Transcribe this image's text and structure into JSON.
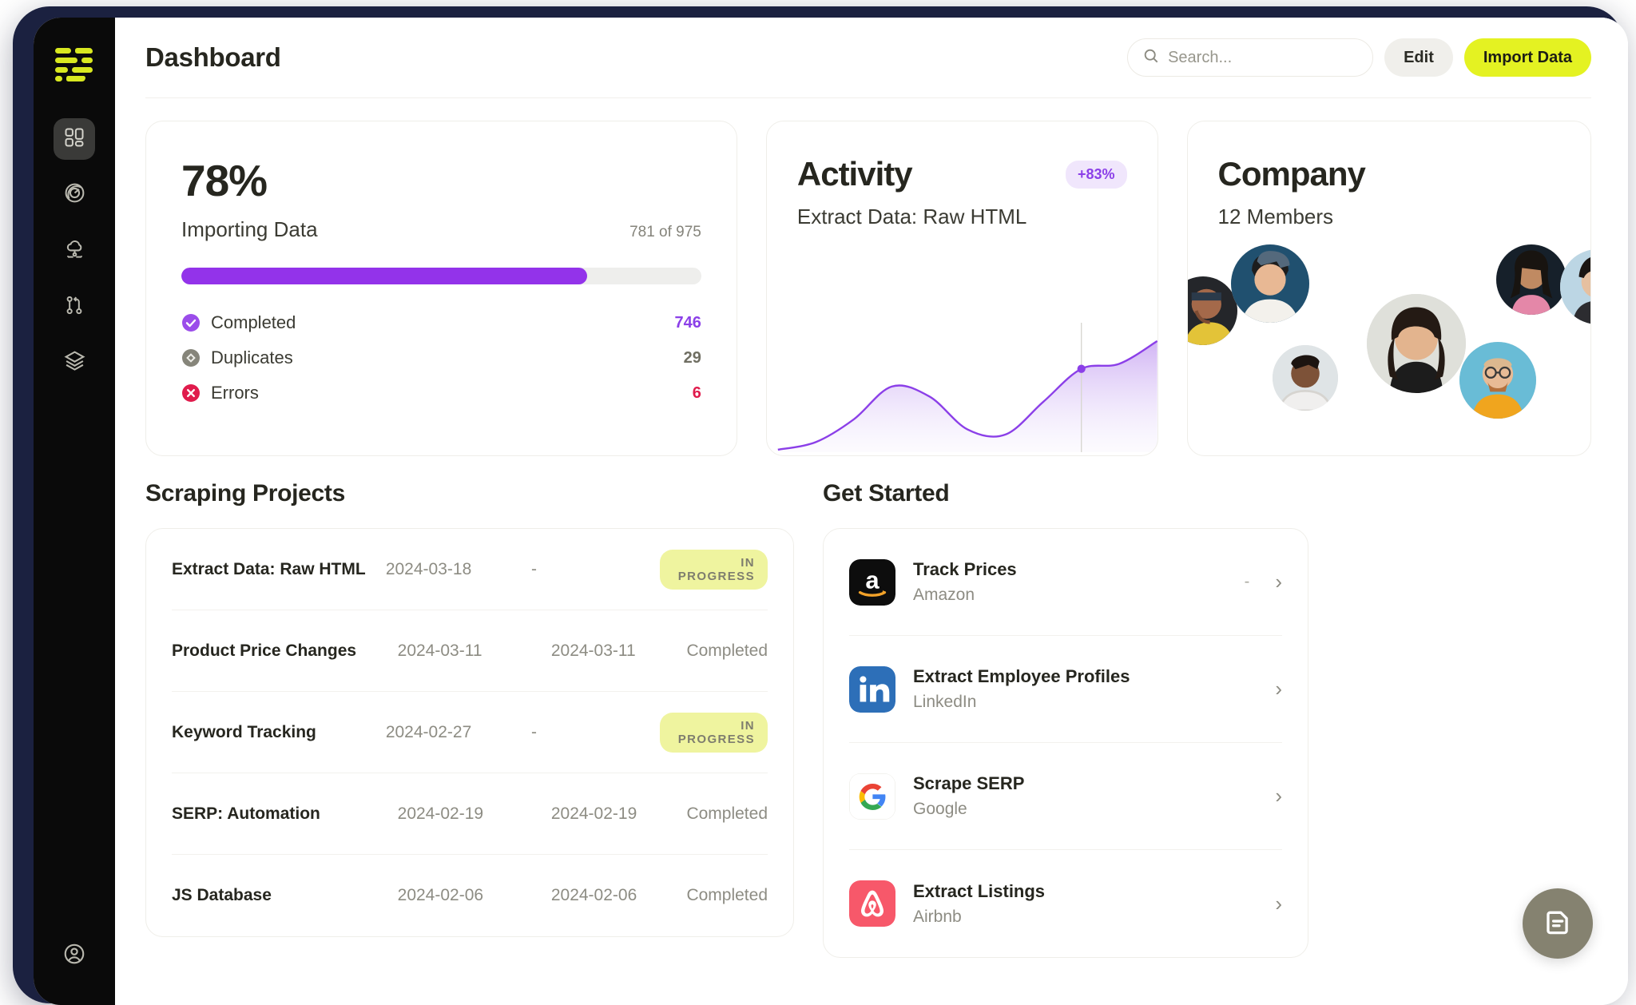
{
  "brand": {
    "logo_name": "app-logo",
    "logo_color": "#d8e820",
    "accent": "#e4f222",
    "purple": "#9333ea"
  },
  "sidebar": {
    "items": [
      {
        "icon": "dashboard-grid-icon",
        "label": "Dashboard",
        "active": true
      },
      {
        "icon": "radar-target-icon",
        "label": "Monitor",
        "active": false
      },
      {
        "icon": "cloud-network-icon",
        "label": "Cloud",
        "active": false
      },
      {
        "icon": "git-branch-icon",
        "label": "Workflows",
        "active": false
      },
      {
        "icon": "layers-icon",
        "label": "Datasets",
        "active": false
      }
    ],
    "account": {
      "icon": "user-circle-icon",
      "label": "Account"
    }
  },
  "header": {
    "title": "Dashboard",
    "search": {
      "placeholder": "Search...",
      "value": "",
      "icon": "search-icon"
    },
    "edit_label": "Edit",
    "import_label": "Import Data"
  },
  "progress_card": {
    "percent": "78%",
    "percent_value": 78,
    "title": "Importing Data",
    "count": "781 of 975",
    "stats": [
      {
        "icon": "check-circle-icon",
        "label": "Completed",
        "value": "746",
        "color": "#9333ea"
      },
      {
        "icon": "diamond-circle-icon",
        "label": "Duplicates",
        "value": "29",
        "color": "#6f6e62"
      },
      {
        "icon": "x-circle-icon",
        "label": "Errors",
        "value": "6",
        "color": "#e01b4c"
      }
    ]
  },
  "activity_card": {
    "title": "Activity",
    "badge": "+83%",
    "subtitle": "Extract Data: Raw HTML"
  },
  "company_card": {
    "title": "Company",
    "subtitle": "12 Members",
    "members": 12
  },
  "projects": {
    "section_title": "Scraping Projects",
    "rows": [
      {
        "name": "Extract Data: Raw HTML",
        "started": "2024-03-18",
        "finished": "-",
        "status": "IN PROGRESS",
        "status_type": "pill"
      },
      {
        "name": "Product Price Changes",
        "started": "2024-03-11",
        "finished": "2024-03-11",
        "status": "Completed",
        "status_type": "plain"
      },
      {
        "name": "Keyword Tracking",
        "started": "2024-02-27",
        "finished": "-",
        "status": "IN PROGRESS",
        "status_type": "pill"
      },
      {
        "name": "SERP: Automation",
        "started": "2024-02-19",
        "finished": "2024-02-19",
        "status": "Completed",
        "status_type": "plain"
      },
      {
        "name": "JS Database",
        "started": "2024-02-06",
        "finished": "2024-02-06",
        "status": "Completed",
        "status_type": "plain"
      }
    ]
  },
  "get_started": {
    "section_title": "Get Started",
    "items": [
      {
        "title": "Track Prices",
        "source": "Amazon",
        "logo": "amazon-logo-icon",
        "trailing": "-",
        "chevron": "chevron-right-icon"
      },
      {
        "title": "Extract Employee Profiles",
        "source": "LinkedIn",
        "logo": "linkedin-logo-icon",
        "trailing": "",
        "chevron": "chevron-right-icon"
      },
      {
        "title": "Scrape SERP",
        "source": "Google",
        "logo": "google-logo-icon",
        "trailing": "",
        "chevron": "chevron-right-icon"
      },
      {
        "title": "Extract Listings",
        "source": "Airbnb",
        "logo": "airbnb-logo-icon",
        "trailing": "",
        "chevron": "chevron-right-icon"
      }
    ]
  },
  "fab": {
    "icon": "chat-document-icon",
    "label": "Support",
    "color": "#858270"
  },
  "chart_data": {
    "type": "area",
    "title": "Activity",
    "series_name": "Extract Data: Raw HTML",
    "x": [
      0,
      1,
      2,
      3,
      4,
      5,
      6,
      7,
      8,
      9,
      10
    ],
    "values": [
      2,
      8,
      26,
      52,
      44,
      18,
      14,
      40,
      66,
      70,
      88
    ],
    "ylim": [
      0,
      100
    ],
    "grid": false,
    "legend": false,
    "marker": {
      "x": 8,
      "y": 66,
      "label": "+83%"
    },
    "line_color": "#8b3fe8",
    "fill_color": "#c9a7f2"
  }
}
